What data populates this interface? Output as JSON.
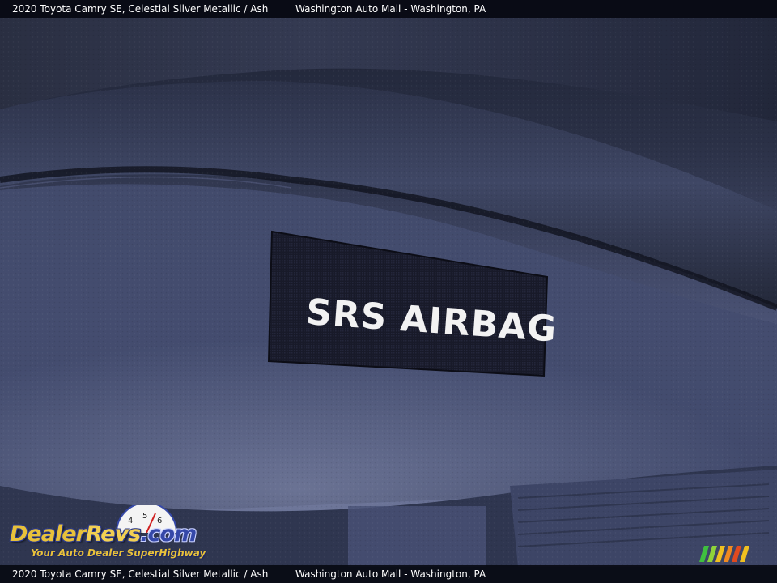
{
  "header": {
    "vehicle": "2020 Toyota Camry SE,   Celestial Silver Metallic / Ash",
    "dealer": "Washington Auto Mall - Washington, PA"
  },
  "photo": {
    "label_text": "SRS AIRBAG",
    "subject": "leather seat airbag tag"
  },
  "footer": {
    "vehicle": "2020 Toyota Camry SE,   Celestial Silver Metallic / Ash",
    "dealer": "Washington Auto Mall - Washington, PA"
  },
  "watermark": {
    "brand_part1": "Dealer",
    "brand_part2": "Revs",
    "brand_part3": ".com",
    "tagline": "Your Auto Dealer SuperHighway",
    "gauge_icon": "speedometer-icon",
    "stripes_icon": "colored-stripes-icon"
  },
  "colors": {
    "caption_bg": "#080a12",
    "leather_dark": "#1f2435",
    "leather_mid": "#3b4260",
    "leather_light": "#6d7598",
    "tag_bg": "#161826",
    "tag_text": "#f2f2f2",
    "brand_yellow": "#e8c13a",
    "brand_blue": "#3548a8"
  }
}
